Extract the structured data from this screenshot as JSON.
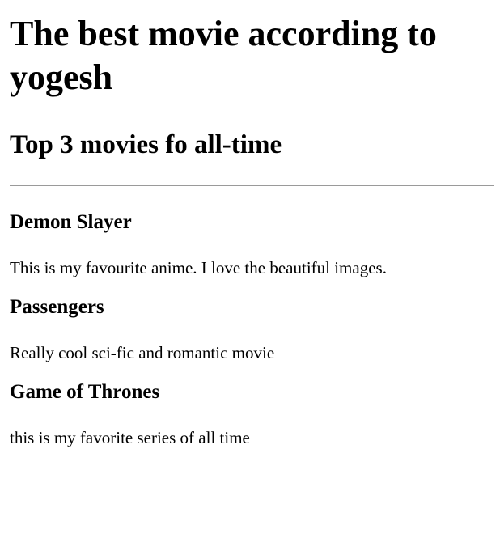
{
  "page": {
    "title": "The best movie according to yogesh",
    "subtitle": "Top 3 movies fo all-time"
  },
  "movies": [
    {
      "name": "Demon Slayer",
      "description": "This is my favourite anime. I love the beautiful images."
    },
    {
      "name": "Passengers",
      "description": "Really cool sci-fic and romantic movie"
    },
    {
      "name": "Game of Thrones",
      "description": "this is my favorite series of all time"
    }
  ]
}
